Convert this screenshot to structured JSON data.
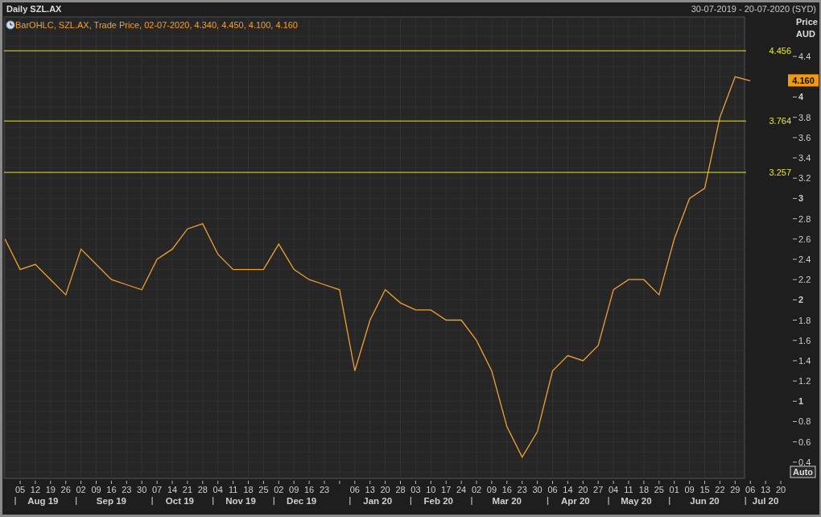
{
  "header": {
    "title": "Daily SZL.AX",
    "range": "30-07-2019 - 20-07-2020 (SYD)"
  },
  "legend": "BarOHLC, SZL.AX, Trade Price, 02-07-2020, 4.340, 4.450, 4.100, 4.160",
  "axis_title": [
    "Price",
    "AUD"
  ],
  "auto_button": "Auto",
  "last_price": "4.160",
  "chart_data": {
    "type": "line",
    "ylim": [
      0.24,
      4.79
    ],
    "yticks": [
      0.4,
      0.6,
      0.8,
      1,
      1.2,
      1.4,
      1.6,
      1.8,
      2,
      2.2,
      2.4,
      2.6,
      2.8,
      3,
      3.2,
      3.4,
      3.6,
      3.8,
      4,
      4.4
    ],
    "categories": [
      null,
      "05",
      "12",
      "19",
      "26",
      "02",
      "09",
      "16",
      "23",
      "30",
      "07",
      "14",
      "21",
      "28",
      "04",
      "11",
      "18",
      "25",
      "02",
      "09",
      "16",
      "23",
      null,
      "06",
      "13",
      "20",
      "28",
      "03",
      "10",
      "17",
      "24",
      "02",
      "09",
      "16",
      "23",
      "30",
      "06",
      "14",
      "20",
      "27",
      "04",
      "11",
      "18",
      "25",
      "01",
      "09",
      "15",
      "22",
      "29",
      "06",
      "13",
      "20"
    ],
    "series": [
      {
        "color": "#f0a030",
        "values": [
          2.6,
          2.3,
          2.35,
          2.2,
          2.05,
          2.5,
          2.35,
          2.2,
          2.15,
          2.1,
          2.4,
          2.5,
          2.7,
          2.75,
          2.45,
          2.3,
          2.3,
          2.3,
          2.55,
          2.3,
          2.2,
          2.15,
          2.1,
          1.3,
          1.8,
          2.1,
          1.97,
          1.9,
          1.9,
          1.8,
          1.8,
          1.6,
          1.3,
          0.75,
          0.45,
          0.7,
          1.3,
          1.45,
          1.4,
          1.55,
          2.1,
          2.2,
          2.2,
          2.05,
          2.6,
          3.0,
          3.1,
          3.8,
          4.2,
          4.16,
          null,
          null
        ]
      }
    ],
    "grid": true,
    "ref_lines": [
      {
        "axis": "y",
        "value": 4.456,
        "label": "4.456"
      },
      {
        "axis": "y",
        "value": 3.764,
        "label": "3.764"
      },
      {
        "axis": "y",
        "value": 3.257,
        "label": "3.257"
      }
    ]
  },
  "months": [
    "Aug 19",
    "Sep 19",
    "Oct 19",
    "Nov 19",
    "Dec 19",
    "Jan 20",
    "Feb 20",
    "Mar 20",
    "Apr 20",
    "May 20",
    "Jun 20",
    "Jul 20"
  ]
}
